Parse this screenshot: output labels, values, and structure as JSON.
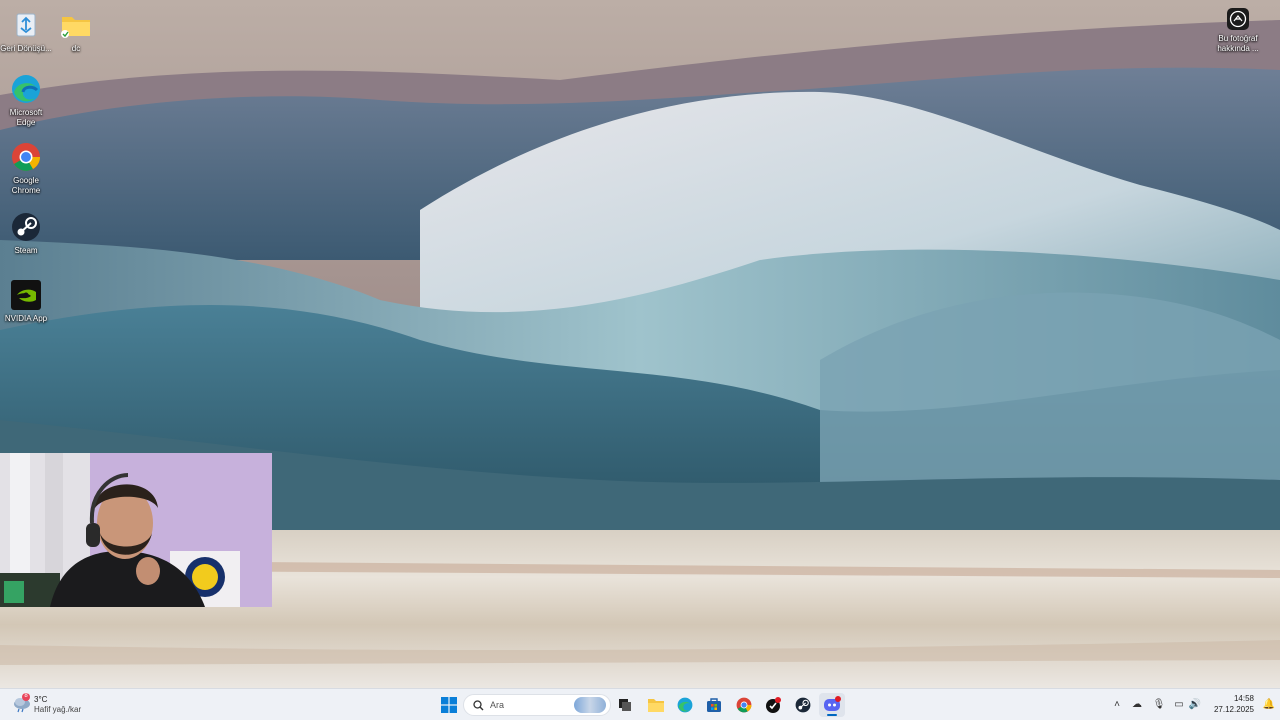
{
  "desktop": {
    "icons": [
      {
        "label": "Geri Dönüşü...",
        "icon": "recycle-bin-icon"
      },
      {
        "label": "dc",
        "icon": "folder-icon"
      },
      {
        "label": "Microsoft Edge",
        "icon": "edge-icon"
      },
      {
        "label": "Google Chrome",
        "icon": "chrome-icon"
      },
      {
        "label": "Steam",
        "icon": "steam-icon"
      },
      {
        "label": "NVIDIA App",
        "icon": "nvidia-icon"
      }
    ],
    "photo_info": {
      "line1": "Bu fotoğraf",
      "line2": "hakkında ...",
      "icon": "camera-icon"
    }
  },
  "webcam": {
    "description_icon": "webcam-overlay"
  },
  "taskbar": {
    "weather": {
      "temp": "3°C",
      "condition": "Hafif yağ./kar",
      "badge": "8"
    },
    "search": {
      "placeholder": "Ara"
    },
    "pinned": [
      "start-icon",
      "search-icon",
      "task-view-icon",
      "file-explorer-icon",
      "edge-icon",
      "store-icon",
      "chrome-icon",
      "app-red-icon",
      "steam-icon",
      "discord-icon"
    ],
    "discord_badge": "",
    "clock": {
      "time": "14:58",
      "date": "27.12.2025"
    },
    "colors": {
      "accent": "#0067c0",
      "taskbar_bg": "#eef1f6"
    }
  }
}
